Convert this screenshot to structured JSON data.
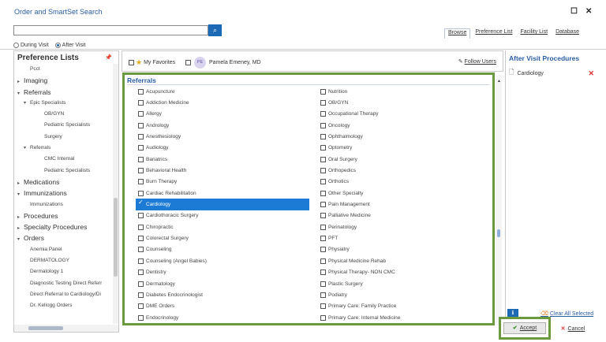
{
  "window": {
    "title": "Order and SmartSet Search"
  },
  "search": {
    "placeholder": ""
  },
  "tabs": [
    "Browse",
    "Preference List",
    "Facility List",
    "Database"
  ],
  "timing": {
    "during_visit": "During Visit",
    "after_visit": "After Visit",
    "selected": "after_visit"
  },
  "left": {
    "title": "Preference Lists",
    "tree": [
      {
        "label": "Pcct",
        "level": 1,
        "arrow": ""
      },
      {
        "label": "Imaging",
        "level": 0,
        "arrow": "▸"
      },
      {
        "label": "Referrals",
        "level": 0,
        "arrow": "▾"
      },
      {
        "label": "Epic Specialists",
        "level": 1,
        "arrow": "▾"
      },
      {
        "label": "OB/GYN",
        "level": 2,
        "arrow": ""
      },
      {
        "label": "Pediatric Specialists",
        "level": 2,
        "arrow": ""
      },
      {
        "label": "Surgery",
        "level": 2,
        "arrow": ""
      },
      {
        "label": "Referrals",
        "level": 1,
        "arrow": "▾"
      },
      {
        "label": "CMC Internal",
        "level": 2,
        "arrow": ""
      },
      {
        "label": "Pediatric Specialists",
        "level": 2,
        "arrow": ""
      },
      {
        "label": "Medications",
        "level": 0,
        "arrow": "▸"
      },
      {
        "label": "Immunizations",
        "level": 0,
        "arrow": "▾"
      },
      {
        "label": "Immunizations",
        "level": 1,
        "arrow": ""
      },
      {
        "label": "Procedures",
        "level": 0,
        "arrow": "▸"
      },
      {
        "label": "Specialty Procedures",
        "level": 0,
        "arrow": "▸"
      },
      {
        "label": "Orders",
        "level": 0,
        "arrow": "▾"
      },
      {
        "label": "Anemia Panel",
        "level": 1,
        "arrow": ""
      },
      {
        "label": "DERMATOLOGY",
        "level": 1,
        "arrow": ""
      },
      {
        "label": "Dermatology 1",
        "level": 1,
        "arrow": ""
      },
      {
        "label": "Diagnostic Testing Direct Referr",
        "level": 1,
        "arrow": ""
      },
      {
        "label": "Direct Referral to Cardiology/Di",
        "level": 1,
        "arrow": ""
      },
      {
        "label": "Dr. Kellogg Orders",
        "level": 1,
        "arrow": ""
      }
    ]
  },
  "header": {
    "my_favorites": "My Favorites",
    "provider_initials": "PE",
    "provider_name": "Pamela Emeney, MD",
    "follow_users": "Follow Users"
  },
  "referrals": {
    "title": "Referrals",
    "col1": [
      {
        "label": "Acupuncture",
        "checked": false
      },
      {
        "label": "Addiction Medicine",
        "checked": false
      },
      {
        "label": "Allergy",
        "checked": false
      },
      {
        "label": "Andrology",
        "checked": false
      },
      {
        "label": "Anesthesiology",
        "checked": false
      },
      {
        "label": "Audiology",
        "checked": false
      },
      {
        "label": "Bariatrics",
        "checked": false
      },
      {
        "label": "Behavioral Health",
        "checked": false
      },
      {
        "label": "Burn Therapy",
        "checked": false
      },
      {
        "label": "Cardiac Rehabilitation",
        "checked": false
      },
      {
        "label": "Cardiology",
        "checked": true
      },
      {
        "label": "Cardiothoracic Surgery",
        "checked": false
      },
      {
        "label": "Chiropractic",
        "checked": false
      },
      {
        "label": "Colorectal Surgery",
        "checked": false
      },
      {
        "label": "Counseling",
        "checked": false
      },
      {
        "label": "Counseling (Angel Babies)",
        "checked": false
      },
      {
        "label": "Dentistry",
        "checked": false
      },
      {
        "label": "Dermatology",
        "checked": false
      },
      {
        "label": "Diabetes Endocrinologist",
        "checked": false
      },
      {
        "label": "DME Orders",
        "checked": false
      },
      {
        "label": "Endocrinology",
        "checked": false
      }
    ],
    "col2": [
      {
        "label": "Nutrition",
        "checked": false
      },
      {
        "label": "OB/GYN",
        "checked": false
      },
      {
        "label": "Occupational Therapy",
        "checked": false
      },
      {
        "label": "Oncology",
        "checked": false
      },
      {
        "label": "Ophthalmology",
        "checked": false
      },
      {
        "label": "Optometry",
        "checked": false
      },
      {
        "label": "Oral Surgery",
        "checked": false
      },
      {
        "label": "Orthopedics",
        "checked": false
      },
      {
        "label": "Orthotics",
        "checked": false
      },
      {
        "label": "Other Specialty",
        "checked": false
      },
      {
        "label": "Pain Management",
        "checked": false
      },
      {
        "label": "Palliative Medicine",
        "checked": false
      },
      {
        "label": "Perinatology",
        "checked": false
      },
      {
        "label": "PFT",
        "checked": false
      },
      {
        "label": "Physiatry",
        "checked": false
      },
      {
        "label": "Physical Medicine Rehab",
        "checked": false
      },
      {
        "label": "Physical Therapy- NON CMC",
        "checked": false
      },
      {
        "label": "Plastic Surgery",
        "checked": false
      },
      {
        "label": "Podiatry",
        "checked": false
      },
      {
        "label": "Primary Care: Family Practice",
        "checked": false
      },
      {
        "label": "Primary Care: Internal Medicine",
        "checked": false
      }
    ]
  },
  "right": {
    "title": "After Visit Procedures",
    "items": [
      "Cardiology"
    ],
    "clear_all": "Clear All Selected"
  },
  "footer": {
    "accept": "Accept",
    "cancel": "Cancel"
  },
  "colors": {
    "accent": "#1c6ab5",
    "highlight": "#6b9a3e",
    "selection": "#1c7bd4"
  }
}
